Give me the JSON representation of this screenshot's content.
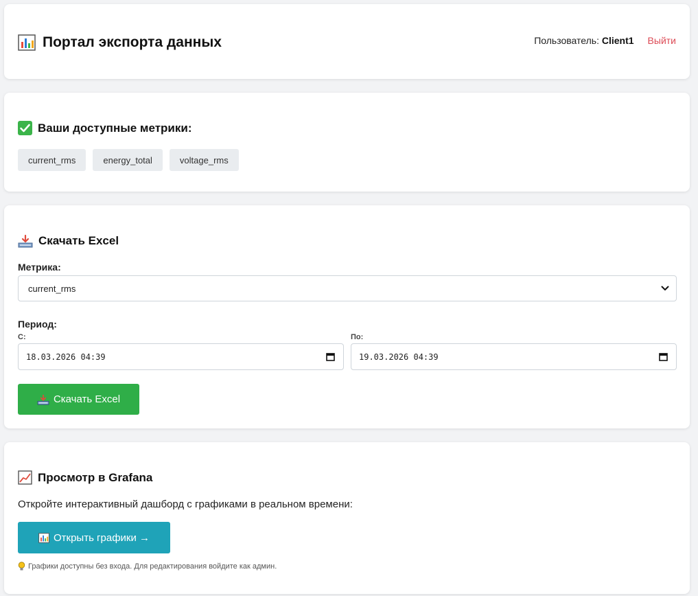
{
  "header": {
    "title": "Портал экспорта данных",
    "user_prefix": "Пользователь:",
    "username": "Client1",
    "logout_label": "Выйти"
  },
  "metrics": {
    "title": "Ваши доступные метрики:",
    "items": [
      "current_rms",
      "energy_total",
      "voltage_rms"
    ]
  },
  "excel": {
    "title": "Скачать Excel",
    "metric_label": "Метрика:",
    "metric_selected": "current_rms",
    "period_label": "Период:",
    "from_label": "С:",
    "from_value": "18.03.2026 04:39",
    "to_label": "По:",
    "to_value": "19.03.2026 04:39",
    "download_label": "Скачать Excel"
  },
  "grafana": {
    "title": "Просмотр в Grafana",
    "description": "Откройте интерактивный дашборд с графиками в реальном времени:",
    "open_label": "Открыть графики →",
    "hint": "Графики доступны без входа. Для редактирования войдите как админ."
  },
  "colors": {
    "download_button": "#2fae48",
    "open_button": "#1fa3b8",
    "logout": "#dc4a55"
  }
}
